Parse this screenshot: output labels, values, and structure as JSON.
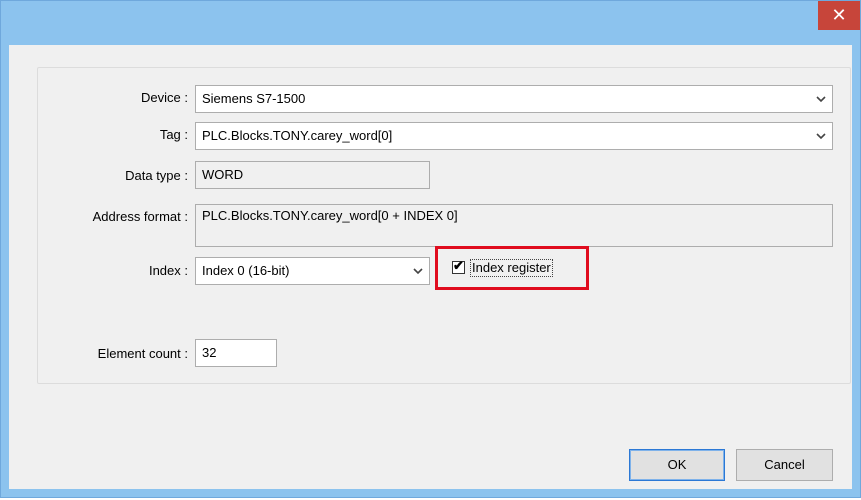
{
  "window": {
    "close_glyph": "✕"
  },
  "form": {
    "device": {
      "label": "Device :",
      "value": "Siemens S7-1500"
    },
    "tag": {
      "label": "Tag :",
      "value": "PLC.Blocks.TONY.carey_word[0]"
    },
    "data_type": {
      "label": "Data type :",
      "value": "WORD"
    },
    "address_format": {
      "label": "Address format :",
      "value": "PLC.Blocks.TONY.carey_word[0 + INDEX 0]"
    },
    "index": {
      "label": "Index :",
      "value": "Index 0 (16-bit)"
    },
    "index_register": {
      "label": "Index register",
      "checked": true,
      "check_glyph": "✔"
    },
    "element_count": {
      "label": "Element count :",
      "value": "32"
    }
  },
  "buttons": {
    "ok": "OK",
    "cancel": "Cancel"
  },
  "colors": {
    "titlebar": "#8cc3ee",
    "close": "#c7453a",
    "highlight": "#e00c1e",
    "client": "#f0f0f0"
  }
}
